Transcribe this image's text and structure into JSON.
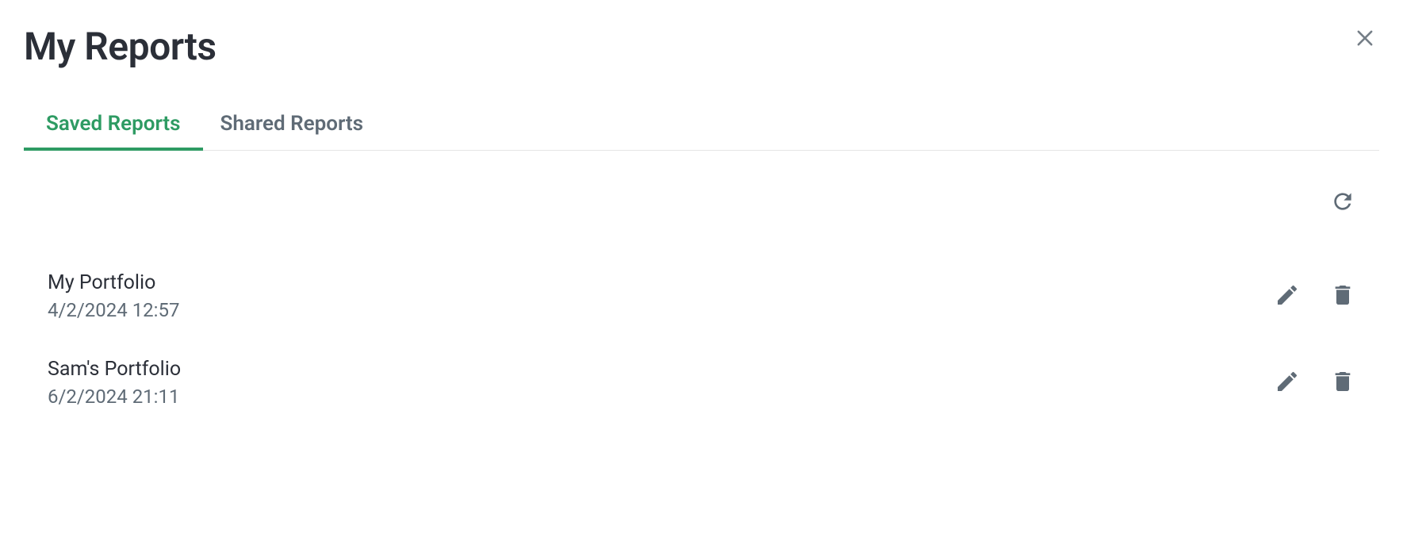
{
  "header": {
    "title": "My Reports"
  },
  "tabs": [
    {
      "label": "Saved Reports",
      "active": true
    },
    {
      "label": "Shared Reports",
      "active": false
    }
  ],
  "reports": [
    {
      "name": "My Portfolio",
      "timestamp": "4/2/2024 12:57"
    },
    {
      "name": "Sam's Portfolio",
      "timestamp": "6/2/2024 21:11"
    }
  ]
}
